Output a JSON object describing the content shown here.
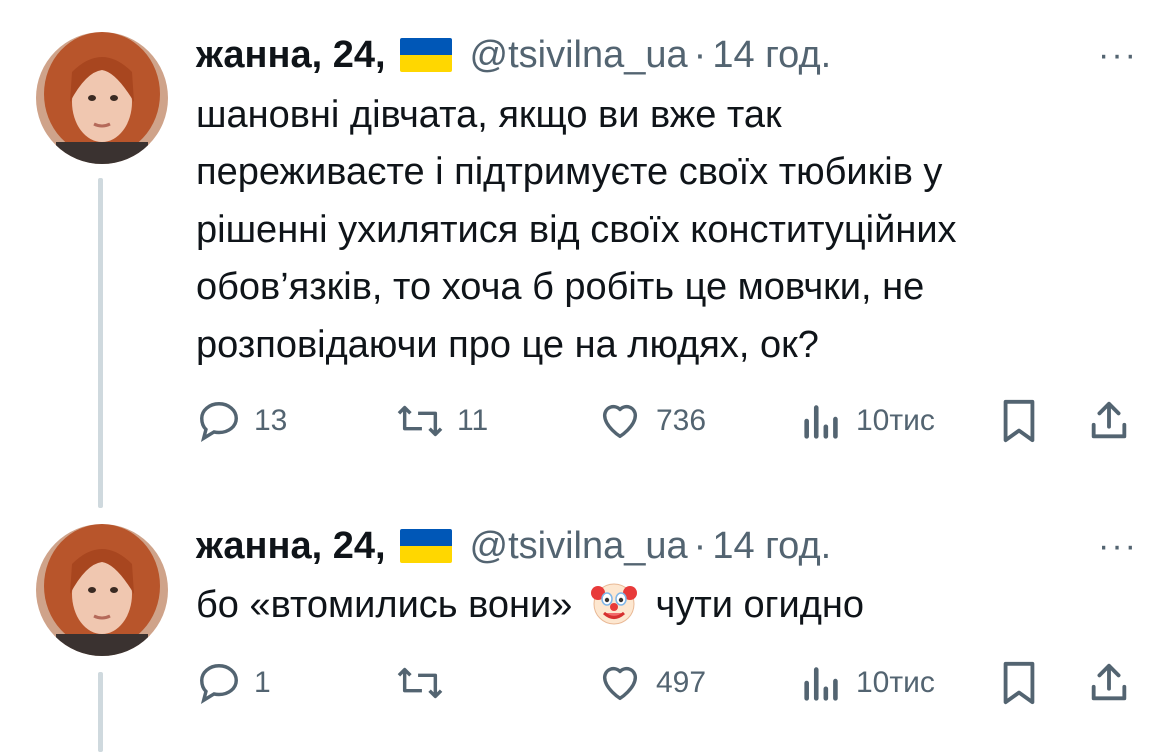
{
  "tweets": [
    {
      "author": {
        "name": "жанна, 24,",
        "handle": "@tsivilna_ua",
        "time": "14 год.",
        "flag": "ukraine-flag"
      },
      "text": "шановні дівчата, якщо ви вже так переживаєте і підтримуєте своїх тюбиків у рішенні ухилятися від своїх конституційних обов’язків, то хоча б робіть це мовчки, не розповідаючи про це на людях, ок?",
      "lines": [
        "шановні дівчата, якщо ви вже так",
        "переживаєте і підтримуєте своїх тюбиків у",
        "рішенні ухилятися від своїх конституційних",
        "обов’язків, то хоча б робіть це мовчки, не",
        "розповідаючи про це на людях, ок?"
      ],
      "metrics": {
        "replies": "13",
        "reposts": "11",
        "likes": "736",
        "views": "10тис"
      }
    },
    {
      "author": {
        "name": "жанна, 24,",
        "handle": "@tsivilna_ua",
        "time": "14 год.",
        "flag": "ukraine-flag"
      },
      "text_before": "бо «втомились вони»",
      "emoji": "clown-face-emoji",
      "text_after": "чути огидно",
      "metrics": {
        "replies": "1",
        "reposts": "",
        "likes": "497",
        "views": "10тис"
      }
    }
  ],
  "header": {
    "separator": "·"
  },
  "more_label": "···",
  "colors": {
    "text": "#0f1419",
    "secondary": "#536471",
    "thread_line": "#cfd9de",
    "flag_blue": "#0057b7",
    "flag_yellow": "#ffd700"
  }
}
